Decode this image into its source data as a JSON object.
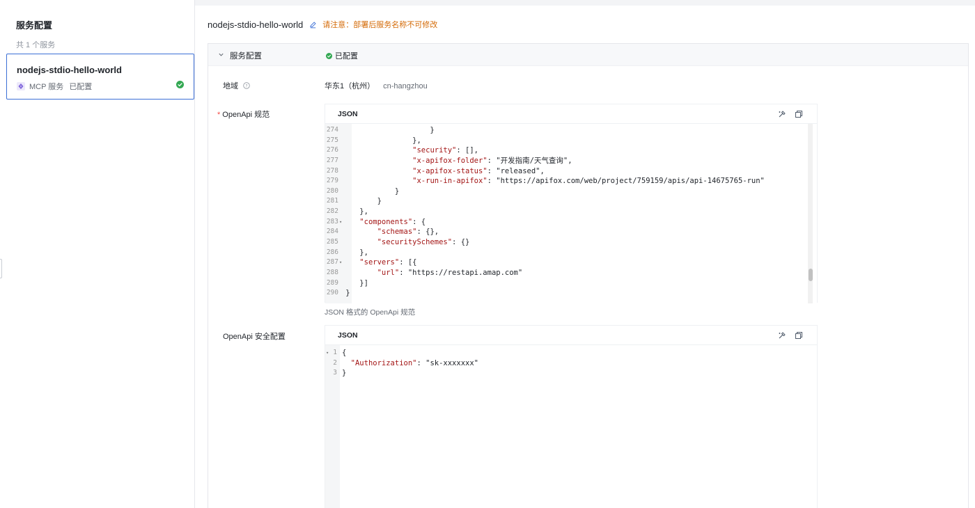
{
  "sidebar": {
    "title": "服务配置",
    "count": "共 1 个服务",
    "service": {
      "name": "nodejs-stdio-hello-world",
      "type": "MCP 服务",
      "status": "已配置"
    }
  },
  "main": {
    "title": "nodejs-stdio-hello-world",
    "warning": "请注意：部署后服务名称不可修改",
    "panel": {
      "title": "服务配置",
      "status": "已配置",
      "region": {
        "label": "地域",
        "value": "华东1（杭州）",
        "code": "cn-hangzhou"
      },
      "openapi": {
        "required_mark": "*",
        "label": "OpenApi 规范",
        "lang": "JSON",
        "hint": "JSON 格式的 OpenApi 规范",
        "lines": [
          {
            "n": "274",
            "fold": "",
            "text": "                }"
          },
          {
            "n": "275",
            "fold": "",
            "text": "            },"
          },
          {
            "n": "276",
            "fold": "",
            "key": "\"security\"",
            "rest": ": [],",
            "indent": "            "
          },
          {
            "n": "277",
            "fold": "",
            "key": "\"x-apifox-folder\"",
            "rest": ": \"开发指南/天气查询\",",
            "indent": "            "
          },
          {
            "n": "278",
            "fold": "",
            "key": "\"x-apifox-status\"",
            "rest": ": \"released\",",
            "indent": "            "
          },
          {
            "n": "279",
            "fold": "",
            "key": "\"x-run-in-apifox\"",
            "rest": ": \"https://apifox.com/web/project/759159/apis/api-14675765-run\"",
            "indent": "            "
          },
          {
            "n": "280",
            "fold": "",
            "text": "        }"
          },
          {
            "n": "281",
            "fold": "",
            "text": "    }"
          },
          {
            "n": "282",
            "fold": "",
            "text": "},"
          },
          {
            "n": "283",
            "fold": "▾",
            "key": "\"components\"",
            "rest": ": {",
            "indent": ""
          },
          {
            "n": "284",
            "fold": "",
            "key": "\"schemas\"",
            "rest": ": {},",
            "indent": "    "
          },
          {
            "n": "285",
            "fold": "",
            "key": "\"securitySchemes\"",
            "rest": ": {}",
            "indent": "    "
          },
          {
            "n": "286",
            "fold": "",
            "text": "},"
          },
          {
            "n": "287",
            "fold": "▾",
            "key": "\"servers\"",
            "rest": ": [{",
            "indent": ""
          },
          {
            "n": "288",
            "fold": "",
            "key": "\"url\"",
            "rest": ": \"https://restapi.amap.com\"",
            "indent": "    "
          },
          {
            "n": "289",
            "fold": "",
            "text": "}]"
          },
          {
            "n": "290",
            "fold": "",
            "text": "}",
            "outdent": true
          }
        ]
      },
      "security": {
        "label": "OpenApi 安全配置",
        "lang": "JSON",
        "lines": [
          {
            "n": "1",
            "fold": "▾",
            "text": "{"
          },
          {
            "n": "2",
            "fold": "",
            "key": "\"Authorization\"",
            "rest": ": \"sk-xxxxxxx\"",
            "indent": "  "
          },
          {
            "n": "3",
            "fold": "",
            "text": "}"
          }
        ]
      }
    }
  },
  "colors": {
    "accent": "#3b6fd6",
    "success": "#34a853",
    "warning": "#d46b08",
    "json_key": "#a31515"
  },
  "icons": [
    "mcp-icon",
    "check-circle-icon",
    "edit-icon",
    "chevron-down-icon",
    "help-icon",
    "format-icon",
    "copy-icon"
  ]
}
